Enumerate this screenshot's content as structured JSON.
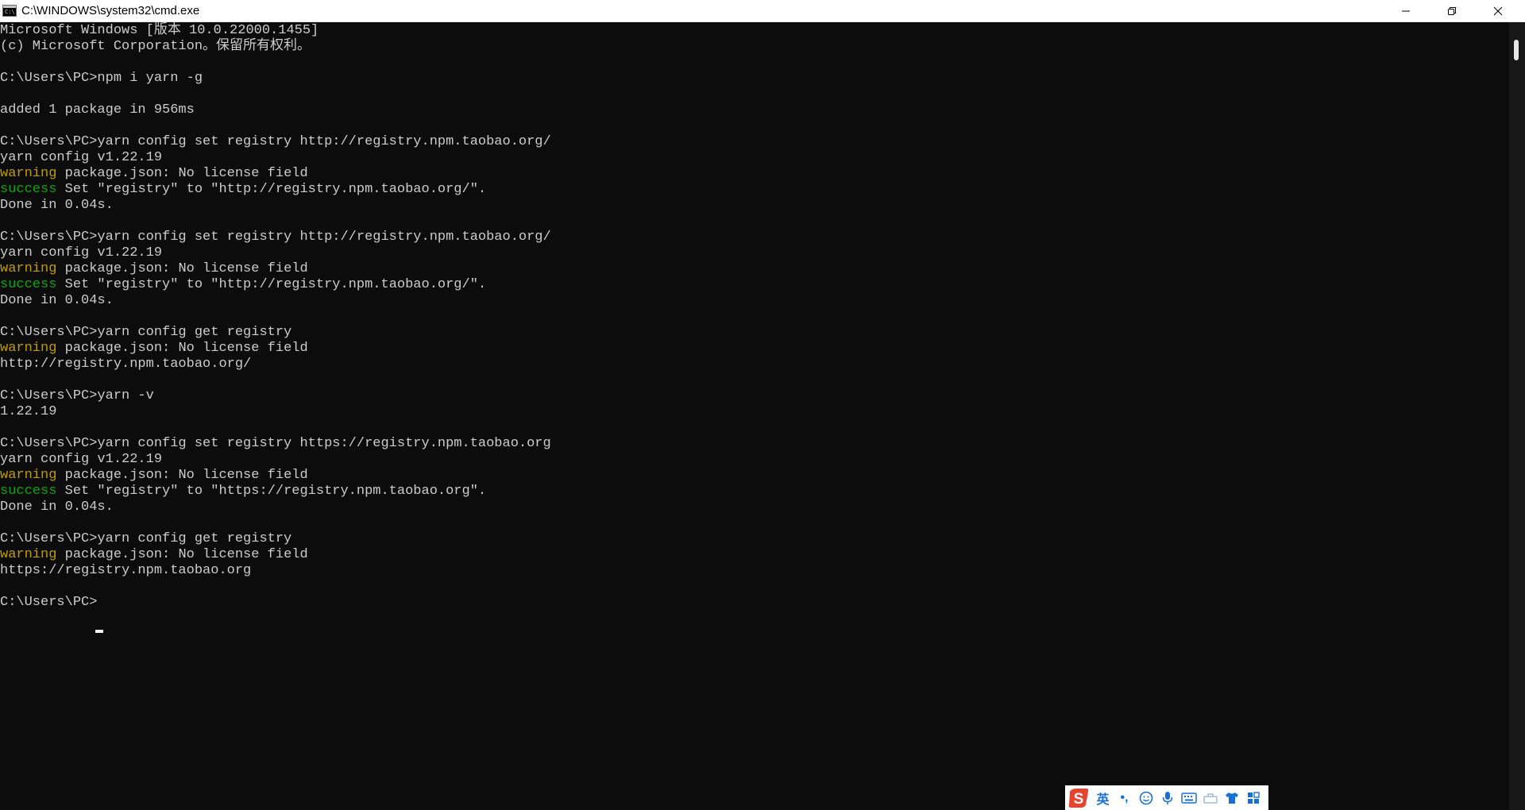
{
  "window": {
    "title": "C:\\WINDOWS\\system32\\cmd.exe",
    "icon_label": "C:\\"
  },
  "controls": {
    "minimize_icon": "minimize-icon",
    "maximize_icon": "restore-icon",
    "close_icon": "close-icon"
  },
  "colors": {
    "background": "#0c0c0c",
    "text": "#cccccc",
    "warning": "#c19c00",
    "success": "#13a10e"
  },
  "console": {
    "lines": [
      {
        "text": "Microsoft Windows [版本 10.0.22000.1455]"
      },
      {
        "text": "(c) Microsoft Corporation。保留所有权利。"
      },
      {
        "text": ""
      },
      {
        "text": "C:\\Users\\PC>npm i yarn -g"
      },
      {
        "text": ""
      },
      {
        "text": "added 1 package in 956ms"
      },
      {
        "text": ""
      },
      {
        "text": "C:\\Users\\PC>yarn config set registry http://registry.npm.taobao.org/"
      },
      {
        "text": "yarn config v1.22.19"
      },
      {
        "prefix": "warning",
        "level": "warn",
        "text": " package.json: No license field"
      },
      {
        "prefix": "success",
        "level": "succ",
        "text": " Set \"registry\" to \"http://registry.npm.taobao.org/\"."
      },
      {
        "text": "Done in 0.04s."
      },
      {
        "text": ""
      },
      {
        "text": "C:\\Users\\PC>yarn config set registry http://registry.npm.taobao.org/"
      },
      {
        "text": "yarn config v1.22.19"
      },
      {
        "prefix": "warning",
        "level": "warn",
        "text": " package.json: No license field"
      },
      {
        "prefix": "success",
        "level": "succ",
        "text": " Set \"registry\" to \"http://registry.npm.taobao.org/\"."
      },
      {
        "text": "Done in 0.04s."
      },
      {
        "text": ""
      },
      {
        "text": "C:\\Users\\PC>yarn config get registry"
      },
      {
        "prefix": "warning",
        "level": "warn",
        "text": " package.json: No license field"
      },
      {
        "text": "http://registry.npm.taobao.org/"
      },
      {
        "text": ""
      },
      {
        "text": "C:\\Users\\PC>yarn -v"
      },
      {
        "text": "1.22.19"
      },
      {
        "text": ""
      },
      {
        "text": "C:\\Users\\PC>yarn config set registry https://registry.npm.taobao.org"
      },
      {
        "text": "yarn config v1.22.19"
      },
      {
        "prefix": "warning",
        "level": "warn",
        "text": " package.json: No license field"
      },
      {
        "prefix": "success",
        "level": "succ",
        "text": " Set \"registry\" to \"https://registry.npm.taobao.org\"."
      },
      {
        "text": "Done in 0.04s."
      },
      {
        "text": ""
      },
      {
        "text": "C:\\Users\\PC>yarn config get registry"
      },
      {
        "prefix": "warning",
        "level": "warn",
        "text": " package.json: No license field"
      },
      {
        "text": "https://registry.npm.taobao.org"
      },
      {
        "text": ""
      },
      {
        "text": "C:\\Users\\PC>"
      }
    ]
  },
  "ime": {
    "language": "英",
    "punctuation": "•,",
    "items": [
      "emoji-icon",
      "microphone-icon",
      "keyboard-icon",
      "toolbox-icon",
      "skin-icon",
      "menu-grid-icon"
    ]
  }
}
